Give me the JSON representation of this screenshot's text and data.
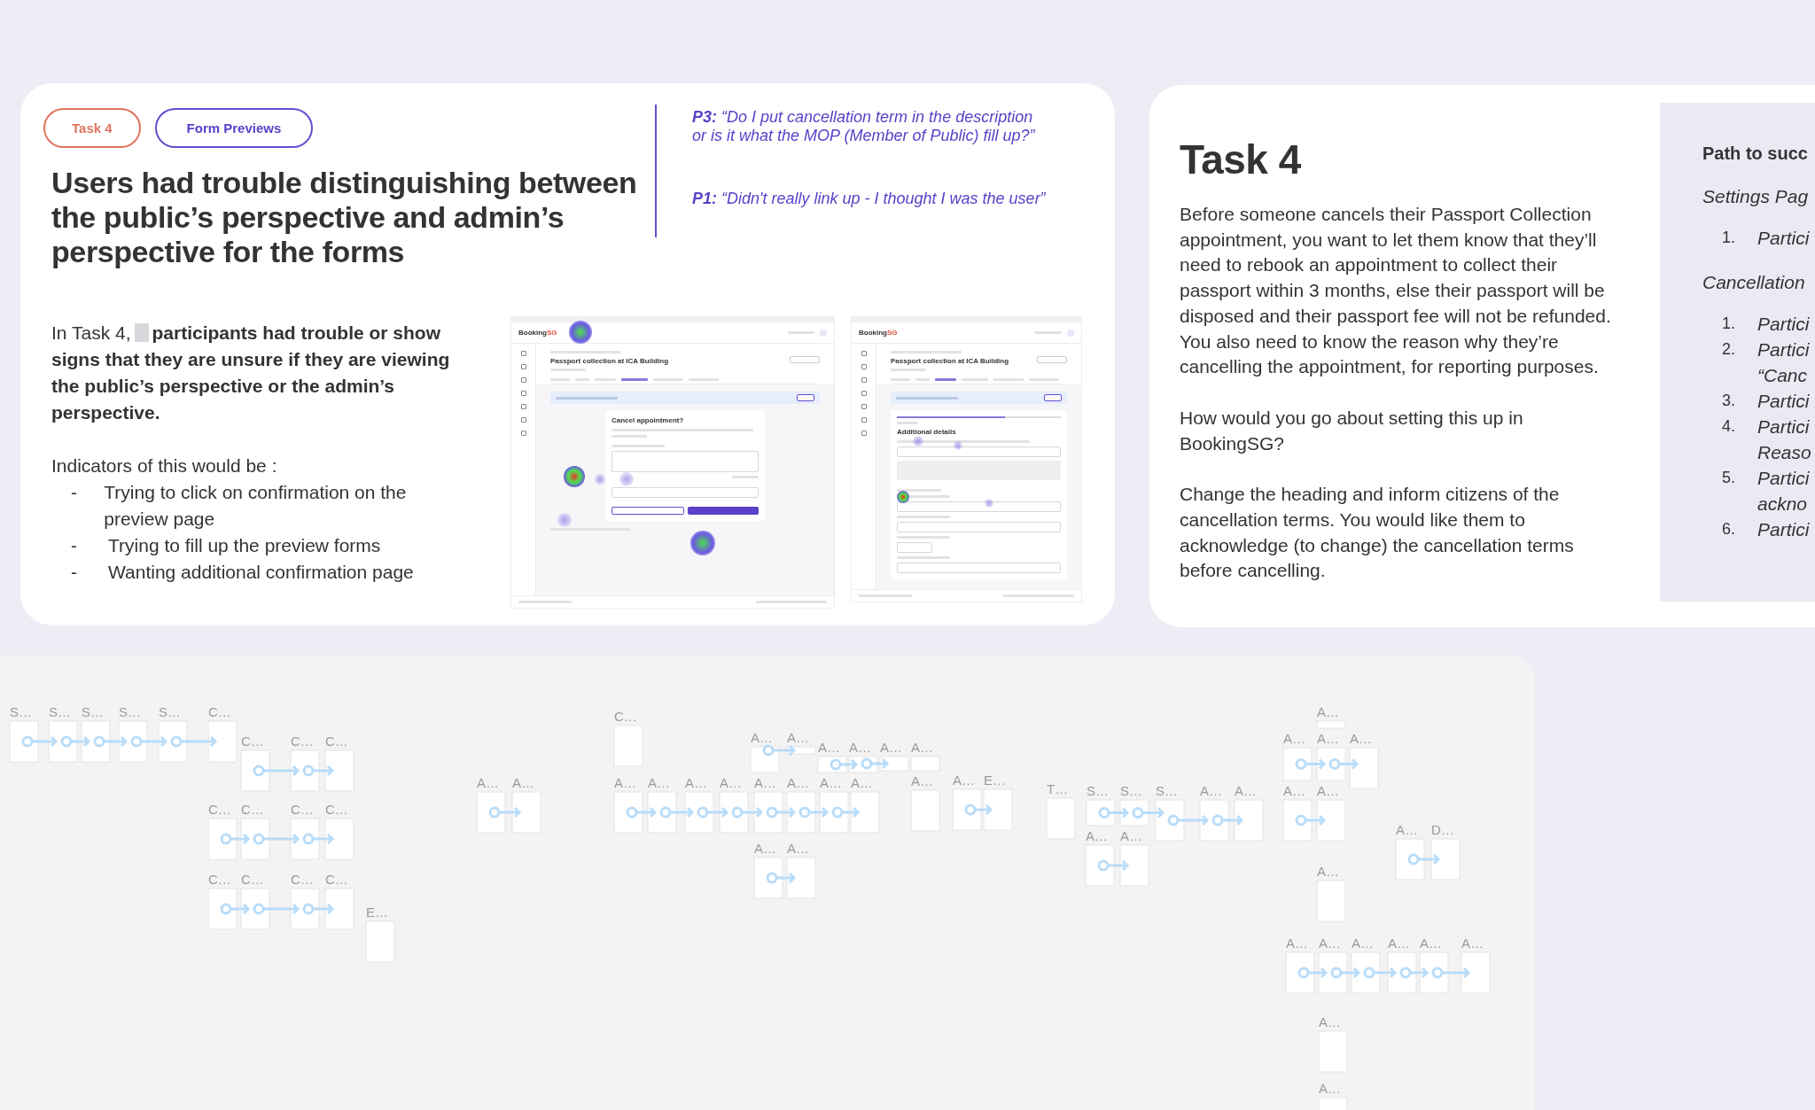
{
  "finding_card": {
    "tags": [
      {
        "label": "Task 4",
        "kind": "task"
      },
      {
        "label": "Form Previews",
        "kind": "topic"
      }
    ],
    "heading": "Users had trouble distinguishing between the public’s perspective and admin’s perspective for the forms",
    "quotes": [
      {
        "speaker": "P3:",
        "text": "“Do I put cancellation term in the description or is it what the MOP (Member of Public) fill up?”"
      },
      {
        "speaker": "P1:",
        "text": "“Didn't really link up - I thought I was the user”"
      }
    ],
    "summary": {
      "lead": "In Task 4,",
      "redacted": true,
      "bold_text": "participants had trouble or show signs that they are unsure if they are viewing the public’s perspective or the admin’s perspective."
    },
    "indicators_title": "Indicators of this would be :",
    "indicators": [
      {
        "bullet": "-",
        "text": "Trying to click on confirmation on the preview page"
      },
      {
        "bullet": "-",
        "text": "Trying to fill up the preview forms"
      },
      {
        "bullet": "-",
        "text": "Wanting additional confirmation page"
      }
    ],
    "previews": [
      {
        "kind": "cancellation",
        "logo": "Booking",
        "logo_accent": "SG",
        "title": "Passport collection at ICA Building",
        "form_heading": "Cancel appointment?"
      },
      {
        "kind": "booking",
        "logo": "Booking",
        "logo_accent": "SG",
        "title": "Passport collection at ICA Building",
        "form_heading": "Additional details",
        "step_progress": {
          "level": 0.66
        }
      }
    ]
  },
  "task_card": {
    "title": "Task 4",
    "paragraphs": [
      "Before someone cancels their Passport Collection appointment, you want to let them know that they’ll need to rebook an appointment to collect their passport within 3 months, else their passport will be disposed and their passport fee will not be refunded. You also need to know the reason why they’re cancelling the appointment, for reporting purposes.",
      "How would you go about setting this up in BookingSG?",
      "Change the heading and inform citizens of the cancellation terms. You would like them to acknowledge (to change) the cancellation terms before cancelling."
    ],
    "success_panel": {
      "title": "Path to succ",
      "sections": [
        {
          "heading": "Settings Pag",
          "items": [
            {
              "number": "1.",
              "lines": [
                "Partici"
              ]
            }
          ]
        },
        {
          "heading": "Cancellation",
          "items": [
            {
              "number": "1.",
              "lines": [
                "Partici"
              ]
            },
            {
              "number": "2.",
              "lines": [
                "Partici",
                "“Canc"
              ]
            },
            {
              "number": "3.",
              "lines": [
                "Partici"
              ]
            },
            {
              "number": "4.",
              "lines": [
                "Partici",
                "Reaso"
              ]
            },
            {
              "number": "5.",
              "lines": [
                "Partici",
                "ackno"
              ]
            },
            {
              "number": "6.",
              "lines": [
                "Partici"
              ]
            }
          ]
        }
      ]
    }
  },
  "flow_canvas": {
    "frames": [
      {
        "label": "S…"
      },
      {
        "label": "S…"
      },
      {
        "label": "S…"
      },
      {
        "label": "S…"
      },
      {
        "label": "S…"
      },
      {
        "label": "C…"
      },
      {
        "label": "C…"
      },
      {
        "label": "C…"
      },
      {
        "label": "C…"
      },
      {
        "label": "C…"
      },
      {
        "label": "C…"
      },
      {
        "label": "C…"
      },
      {
        "label": "C…"
      },
      {
        "label": "C…"
      },
      {
        "label": "C…"
      },
      {
        "label": "C…"
      },
      {
        "label": "C…"
      },
      {
        "label": "E…"
      },
      {
        "label": "C…"
      },
      {
        "label": "A…"
      },
      {
        "label": "A…"
      },
      {
        "label": "A…"
      },
      {
        "label": "A…"
      },
      {
        "label": "A…"
      },
      {
        "label": "A…"
      },
      {
        "label": "A…"
      },
      {
        "label": "A…"
      },
      {
        "label": "A…"
      },
      {
        "label": "A…"
      },
      {
        "label": "A…"
      },
      {
        "label": "A…"
      },
      {
        "label": "A…"
      },
      {
        "label": "A…"
      },
      {
        "label": "A…"
      },
      {
        "label": "A…"
      },
      {
        "label": "A…"
      },
      {
        "label": "A…"
      },
      {
        "label": "A…"
      },
      {
        "label": "A…"
      },
      {
        "label": "E…"
      },
      {
        "label": "T…"
      },
      {
        "label": "S…"
      },
      {
        "label": "S…"
      },
      {
        "label": "S…"
      },
      {
        "label": "A…"
      },
      {
        "label": "A…"
      },
      {
        "label": "A…"
      },
      {
        "label": "A…"
      },
      {
        "label": "A…"
      },
      {
        "label": "A…"
      },
      {
        "label": "A…"
      },
      {
        "label": "A…"
      },
      {
        "label": "A…"
      },
      {
        "label": "A…"
      },
      {
        "label": "A…"
      },
      {
        "label": "D…"
      },
      {
        "label": "A…"
      },
      {
        "label": "A…"
      },
      {
        "label": "A…"
      },
      {
        "label": "A…"
      },
      {
        "label": "A…"
      },
      {
        "label": "A…"
      },
      {
        "label": "A…"
      },
      {
        "label": "A…"
      },
      {
        "label": "A…"
      }
    ]
  }
}
